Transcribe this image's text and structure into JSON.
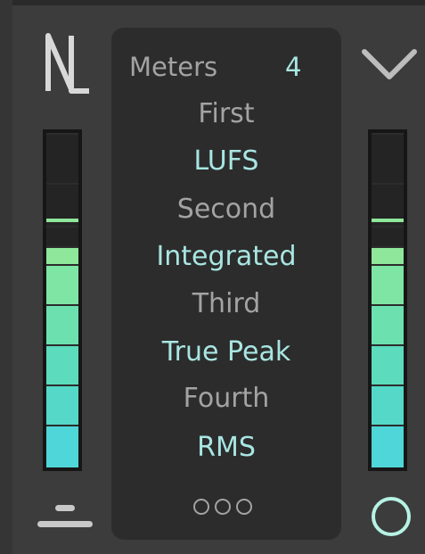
{
  "header": {
    "title": "Meters",
    "count": "4"
  },
  "meters_list": [
    {
      "slot": "First",
      "type": "LUFS"
    },
    {
      "slot": "Second",
      "type": "Integrated"
    },
    {
      "slot": "Third",
      "type": "True Peak"
    },
    {
      "slot": "Fourth",
      "type": "RMS"
    }
  ],
  "icons": {
    "logo": "nl-logo-icon",
    "collapse": "chevron-down-icon",
    "more": "more-dots-icon",
    "menu": "menu-lines-icon",
    "circle": "circle-button-icon"
  },
  "colors": {
    "accent": "#a8e6e2",
    "muted_text": "#a3a3a3",
    "panel_bg": "#2c2c2c",
    "app_bg": "#3c3c3c",
    "meter_gradient_top": "#8ee79a",
    "meter_gradient_bottom": "#4fd6d8"
  }
}
